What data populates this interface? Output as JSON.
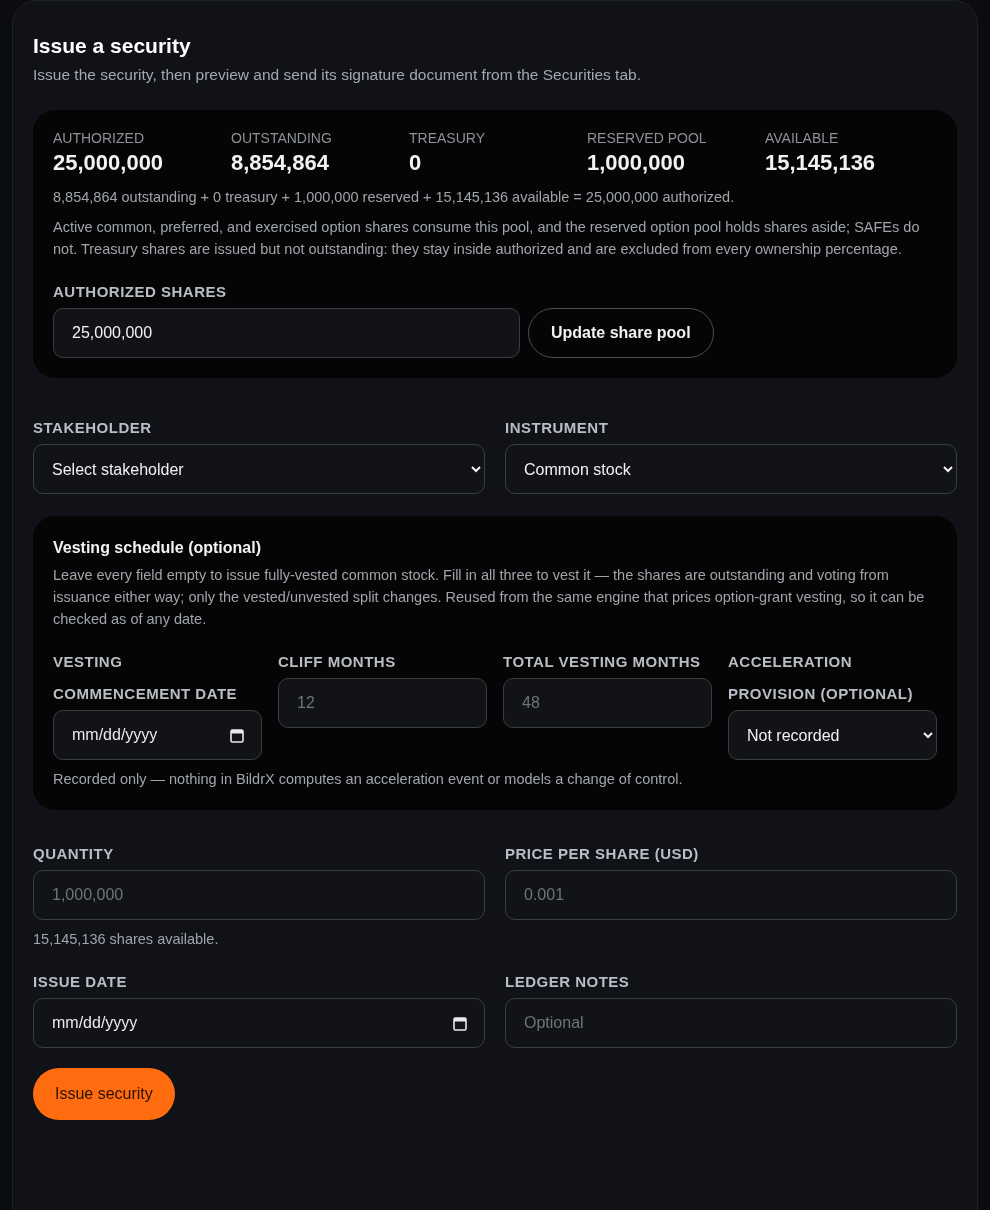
{
  "form": {
    "title": "Issue a security",
    "subtitle": "Issue the security, then preview and send its signature document from the Securities tab."
  },
  "pool": {
    "stats": [
      {
        "label": "AUTHORIZED",
        "value": "25,000,000"
      },
      {
        "label": "OUTSTANDING",
        "value": "8,854,864"
      },
      {
        "label": "TREASURY",
        "value": "0"
      },
      {
        "label": "RESERVED POOL",
        "value": "1,000,000"
      },
      {
        "label": "AVAILABLE",
        "value": "15,145,136"
      }
    ],
    "equation": "8,854,864 outstanding + 0 treasury + 1,000,000 reserved + 15,145,136 available = 25,000,000 authorized.",
    "explanation": "Active common, preferred, and exercised option shares consume this pool, and the reserved option pool holds shares aside; SAFEs do not. Treasury shares are issued but not outstanding: they stay inside authorized and are excluded from every ownership percentage.",
    "authorized_field": {
      "label": "AUTHORIZED SHARES",
      "value": "25,000,000"
    },
    "update_button": "Update share pool"
  },
  "selects": [
    {
      "kind": "select",
      "label": "STAKEHOLDER",
      "value": "Select stakeholder"
    },
    {
      "kind": "select",
      "label": "INSTRUMENT",
      "value": "Common stock"
    }
  ],
  "vesting": {
    "title": "Vesting schedule (optional)",
    "description": "Leave every field empty to issue fully-vested common stock. Fill in all three to vest it — the shares are outstanding and voting from issuance either way; only the vested/unvested split changes. Reused from the same engine that prices option-grant vesting, so it can be checked as of any date.",
    "fields": [
      {
        "kind": "date",
        "label": "VESTING COMMENCEMENT DATE",
        "placeholder": "mm/dd/yyyy"
      },
      {
        "kind": "text",
        "label": "CLIFF MONTHS",
        "placeholder": "12"
      },
      {
        "kind": "text",
        "label": "TOTAL VESTING MONTHS",
        "placeholder": "48"
      },
      {
        "kind": "select",
        "label": "ACCELERATION PROVISION (OPTIONAL)",
        "value": "Not recorded"
      }
    ],
    "note": "Recorded only — nothing in BildrX computes an acceleration event or models a change of control."
  },
  "amount_fields": [
    {
      "kind": "text",
      "label": "QUANTITY",
      "placeholder": "1,000,000"
    },
    {
      "kind": "text",
      "label": "PRICE PER SHARE (USD)",
      "placeholder": "0.001"
    }
  ],
  "availability_note": "15,145,136 shares available.",
  "detail_fields": [
    {
      "kind": "date",
      "label": "ISSUE DATE",
      "placeholder": "mm/dd/yyyy"
    },
    {
      "kind": "text",
      "label": "LEDGER NOTES",
      "placeholder": "Optional"
    }
  ],
  "submit_button": "Issue security"
}
